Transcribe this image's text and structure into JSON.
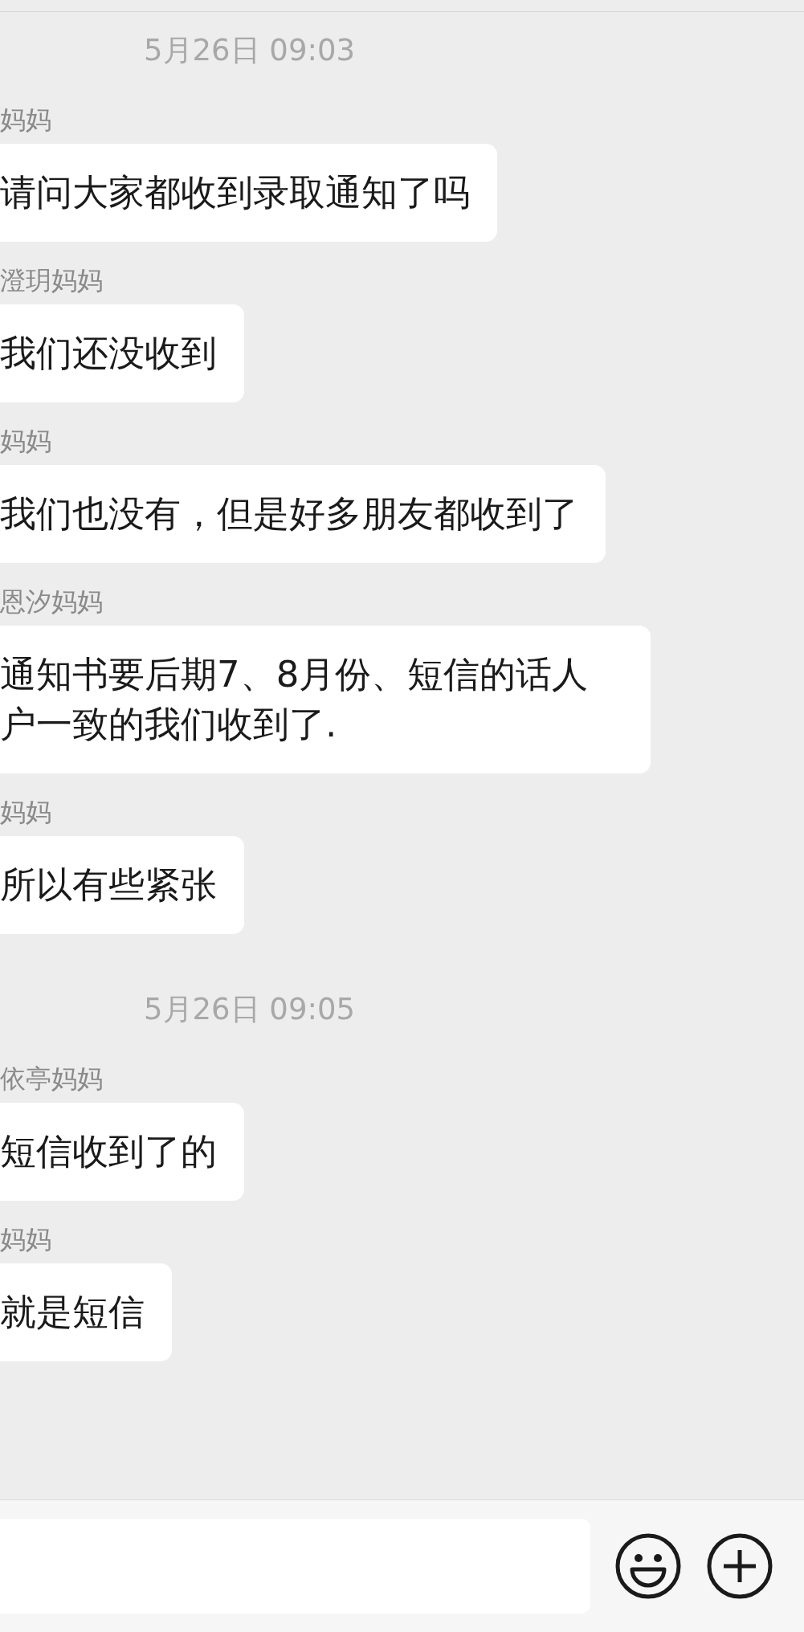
{
  "messages": [
    {
      "kind": "time",
      "text": "5月26日 09:03"
    },
    {
      "kind": "message",
      "sender": "妈妈",
      "text": "请问大家都收到录取通知了吗"
    },
    {
      "kind": "message",
      "sender": "澄玥妈妈",
      "text": "我们还没收到"
    },
    {
      "kind": "message",
      "sender": "妈妈",
      "text": "我们也没有，但是好多朋友都收到了"
    },
    {
      "kind": "message",
      "sender": "恩汐妈妈",
      "text": "通知书要后期7、8月份、短信的话人户一致的我们收到了."
    },
    {
      "kind": "message",
      "sender": "妈妈",
      "text": "所以有些紧张"
    },
    {
      "kind": "time",
      "text": "5月26日 09:05"
    },
    {
      "kind": "message",
      "sender": "依亭妈妈",
      "text": "短信收到了的"
    },
    {
      "kind": "message",
      "sender": "妈妈",
      "text": "就是短信"
    }
  ]
}
